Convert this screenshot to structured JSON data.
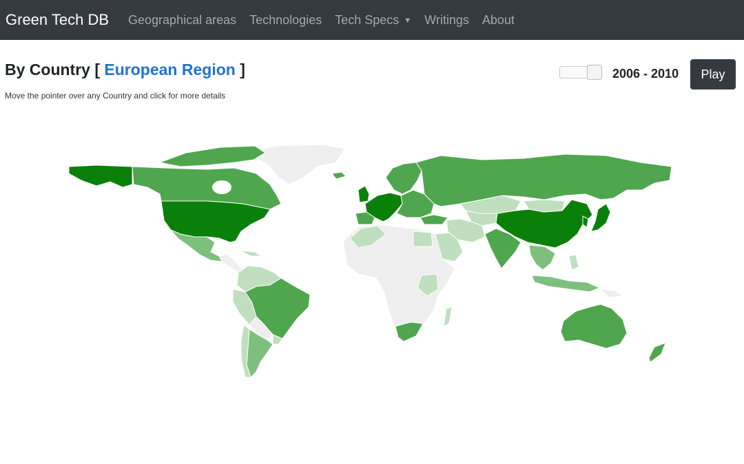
{
  "navbar": {
    "brand": "Green Tech DB",
    "links": [
      "Geographical areas",
      "Technologies",
      "Tech Specs",
      "Writings",
      "About"
    ]
  },
  "header": {
    "title_prefix": "By Country",
    "bracket_open": "[",
    "region_link": "European Region",
    "bracket_close": "]",
    "subtitle": "Move the pointer over any Country and click for more details"
  },
  "controls": {
    "year_range": "2006 - 2010",
    "play_label": "Play",
    "slider_level": 1.0
  },
  "colors": {
    "navbar_bg": "#343a40",
    "link": "#1f73d1",
    "map_darkest": "#0a800a",
    "map_dark": "#4fa64f",
    "map_medium": "#7dbf7d",
    "map_light": "#bfdfbf",
    "map_none": "#eeeeee"
  },
  "map_legend_levels": [
    "darkest",
    "dark",
    "medium",
    "light",
    "none"
  ]
}
